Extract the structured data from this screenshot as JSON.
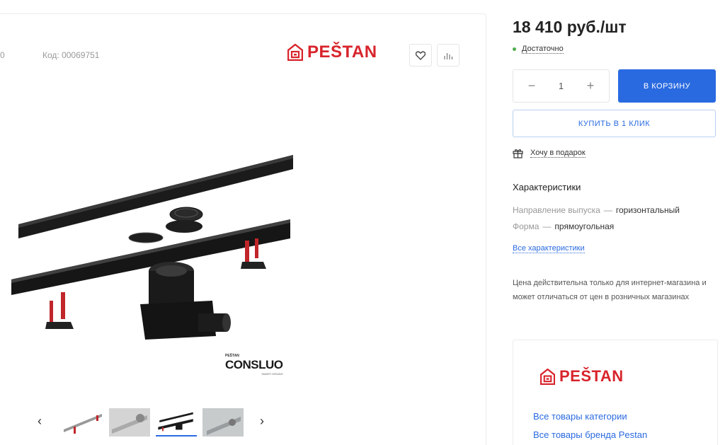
{
  "product": {
    "article_fragment": "0",
    "code": "Код: 00069751",
    "brand_name": "PEŠTAN"
  },
  "image": {
    "badge_top": "PEŠTAN",
    "badge_main": "CONSLUO",
    "badge_sub": "SMART DRAINS"
  },
  "buy": {
    "price": "18 410 руб./шт",
    "stock": "Достаточно",
    "quantity": "1",
    "minus": "−",
    "plus": "+",
    "cart_label": "В КОРЗИНУ",
    "oneclick_label": "КУПИТЬ В 1 КЛИК",
    "gift_label": "Хочу в подарок"
  },
  "characteristics": {
    "title": "Характеристики",
    "rows": [
      {
        "key": "Направление выпуска",
        "sep": "—",
        "value": "горизонтальный"
      },
      {
        "key": "Форма",
        "sep": "—",
        "value": "прямоугольная"
      }
    ],
    "all_link": "Все характеристики"
  },
  "note": "Цена действительна только для интернет-магазина и может отличаться от цен в розничных магазинах",
  "brand_box": {
    "brand_name": "PEŠTAN",
    "link_category": "Все товары категории",
    "link_brand": "Все товары бренда Pestan"
  },
  "gallery": {
    "prev_icon": "‹",
    "next_icon": "›"
  },
  "colors": {
    "accent": "#2a6ae0",
    "brand_red": "#d8242c",
    "stock_green": "#4cae4c"
  }
}
